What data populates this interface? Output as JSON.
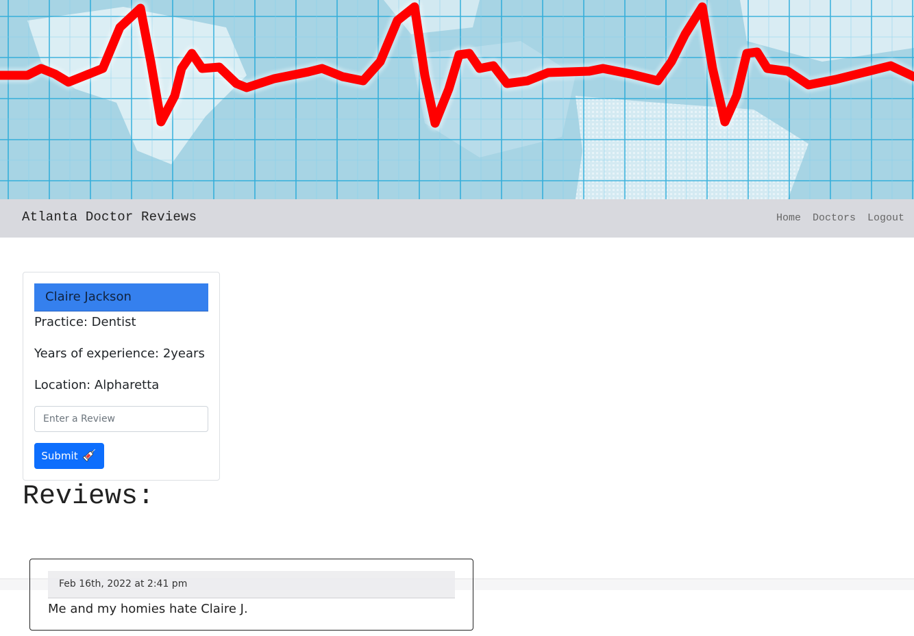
{
  "navbar": {
    "brand": "Atlanta Doctor Reviews",
    "links": [
      "Home",
      "Doctors",
      "Logout"
    ]
  },
  "doctor": {
    "name": "Claire Jackson",
    "practice": "Practice: Dentist",
    "experience": "Years of experience: 2years",
    "location": "Location: Alpharetta"
  },
  "review_form": {
    "placeholder": "Enter a Review",
    "submit_label": "Submit",
    "submit_icon": "syringe-icon"
  },
  "reviews": {
    "heading": "Reviews:",
    "items": [
      {
        "date": "Feb 16th, 2022 at 2:41 pm",
        "text": "Me and my homies hate Claire J."
      }
    ]
  },
  "colors": {
    "hero_line": "#ff0000",
    "card_header": "#3580ee",
    "submit_button": "#0d6efd",
    "navbar_bg": "#d8d9de"
  }
}
